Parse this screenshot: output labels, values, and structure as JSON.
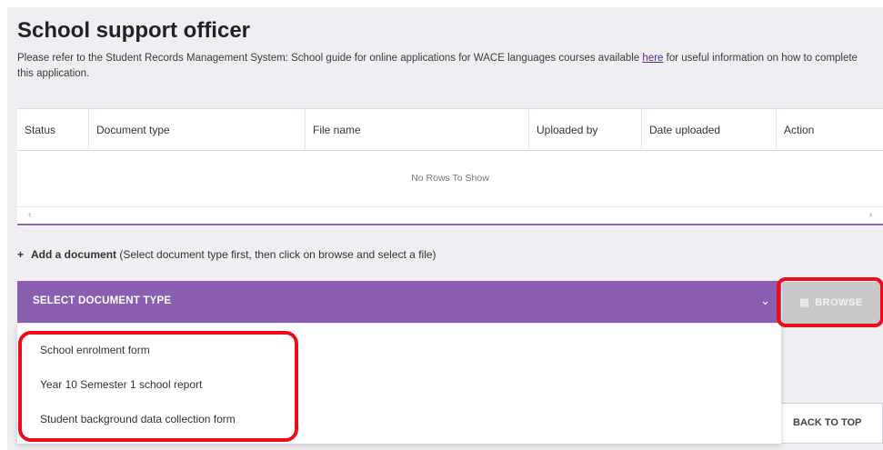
{
  "page": {
    "title": "School support officer",
    "intro_text": "Please refer to the Student Records Management System: School guide for online applications for WACE languages courses available",
    "intro_link": "here",
    "intro_tail": " for useful information on how to complete this application."
  },
  "grid": {
    "columns": [
      "Status",
      "Document type",
      "File name",
      "Uploaded by",
      "Date uploaded",
      "Action"
    ],
    "empty_message": "No Rows To Show",
    "scroll_left": "‹",
    "scroll_right": "›"
  },
  "add_document": {
    "plus": "+",
    "label": "Add a document",
    "hint": " (Select document type first, then click on browse and select a file)"
  },
  "document_type_select": {
    "placeholder": "SELECT DOCUMENT TYPE",
    "chevron": "⌄",
    "options": [
      "School enrolment form",
      "Year 10 Semester 1 school report",
      "Student background data collection form"
    ]
  },
  "browse_button": {
    "icon": "file-icon",
    "glyph": "▤",
    "label": "BROWSE"
  },
  "back_to_top": {
    "label": "BACK TO TOP"
  },
  "colors": {
    "accent_purple": "#8a5fb1",
    "highlight_red": "#ee0c1b",
    "disabled_grey": "#c9c9cc"
  }
}
